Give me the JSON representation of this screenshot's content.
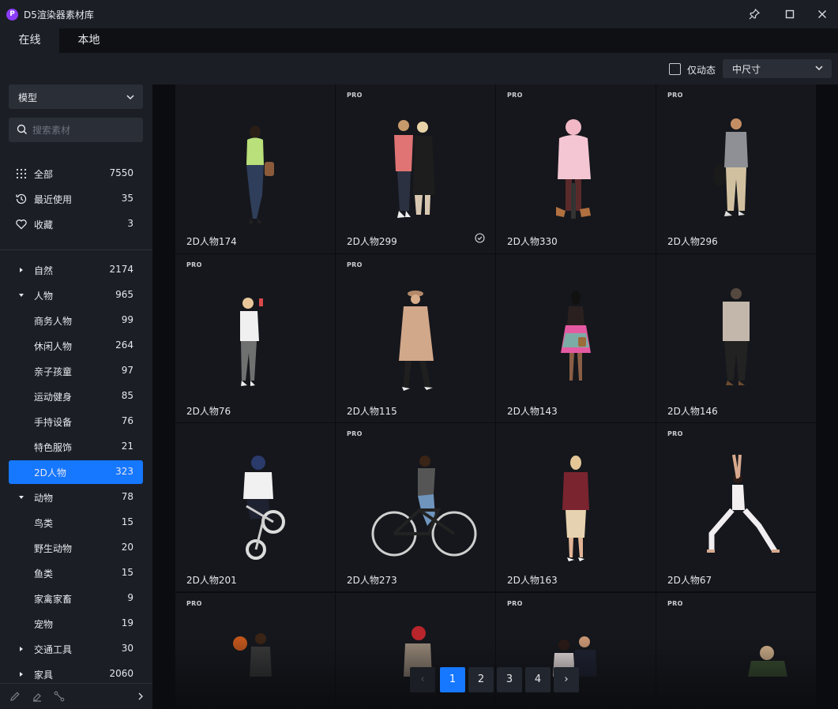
{
  "window": {
    "title": "D5渲染器素材库",
    "logo_letter": "P"
  },
  "tabs": [
    {
      "label": "在线",
      "active": true
    },
    {
      "label": "本地",
      "active": false
    }
  ],
  "toolbar": {
    "animated_only_label": "仅动态",
    "size_select": "中尺寸"
  },
  "sidebar": {
    "type_select": "模型",
    "search_placeholder": "搜索素材",
    "quick": [
      {
        "label": "全部",
        "count": "7550",
        "icon": "grid-icon"
      },
      {
        "label": "最近使用",
        "count": "35",
        "icon": "history-icon"
      },
      {
        "label": "收藏",
        "count": "3",
        "icon": "heart-icon"
      }
    ],
    "categories": [
      {
        "label": "自然",
        "count": "2174",
        "level": 0,
        "expanded": false
      },
      {
        "label": "人物",
        "count": "965",
        "level": 0,
        "expanded": true
      },
      {
        "label": "商务人物",
        "count": "99",
        "level": 1
      },
      {
        "label": "休闲人物",
        "count": "264",
        "level": 1
      },
      {
        "label": "亲子孩童",
        "count": "97",
        "level": 1
      },
      {
        "label": "运动健身",
        "count": "85",
        "level": 1
      },
      {
        "label": "手持设备",
        "count": "76",
        "level": 1
      },
      {
        "label": "特色服饰",
        "count": "21",
        "level": 1
      },
      {
        "label": "2D人物",
        "count": "323",
        "level": 1,
        "active": true
      },
      {
        "label": "动物",
        "count": "78",
        "level": 0,
        "expanded": true
      },
      {
        "label": "鸟类",
        "count": "15",
        "level": 1
      },
      {
        "label": "野生动物",
        "count": "20",
        "level": 1
      },
      {
        "label": "鱼类",
        "count": "15",
        "level": 1
      },
      {
        "label": "家禽家畜",
        "count": "9",
        "level": 1
      },
      {
        "label": "宠物",
        "count": "19",
        "level": 1
      },
      {
        "label": "交通工具",
        "count": "30",
        "level": 0,
        "expanded": false
      },
      {
        "label": "家具",
        "count": "2060",
        "level": 0,
        "expanded": false
      }
    ]
  },
  "assets": [
    {
      "name": "2D人物174",
      "pro": false
    },
    {
      "name": "2D人物299",
      "pro": true,
      "downloaded": true
    },
    {
      "name": "2D人物330",
      "pro": true
    },
    {
      "name": "2D人物296",
      "pro": true
    },
    {
      "name": "2D人物76",
      "pro": true
    },
    {
      "name": "2D人物115",
      "pro": true
    },
    {
      "name": "2D人物143",
      "pro": false
    },
    {
      "name": "2D人物146",
      "pro": false
    },
    {
      "name": "2D人物201",
      "pro": false
    },
    {
      "name": "2D人物273",
      "pro": true
    },
    {
      "name": "2D人物163",
      "pro": false
    },
    {
      "name": "2D人物67",
      "pro": true
    },
    {
      "name": "",
      "pro": true
    },
    {
      "name": "",
      "pro": false
    },
    {
      "name": "",
      "pro": true
    },
    {
      "name": "",
      "pro": true
    }
  ],
  "pro_badge": "PRO",
  "pagination": {
    "pages": [
      "1",
      "2",
      "3",
      "4"
    ],
    "current": "1",
    "prev": "‹",
    "next": "›"
  },
  "colors": {
    "accent": "#1677ff",
    "background": "#1b1e25",
    "grid_bg": "#0b0c0f"
  }
}
